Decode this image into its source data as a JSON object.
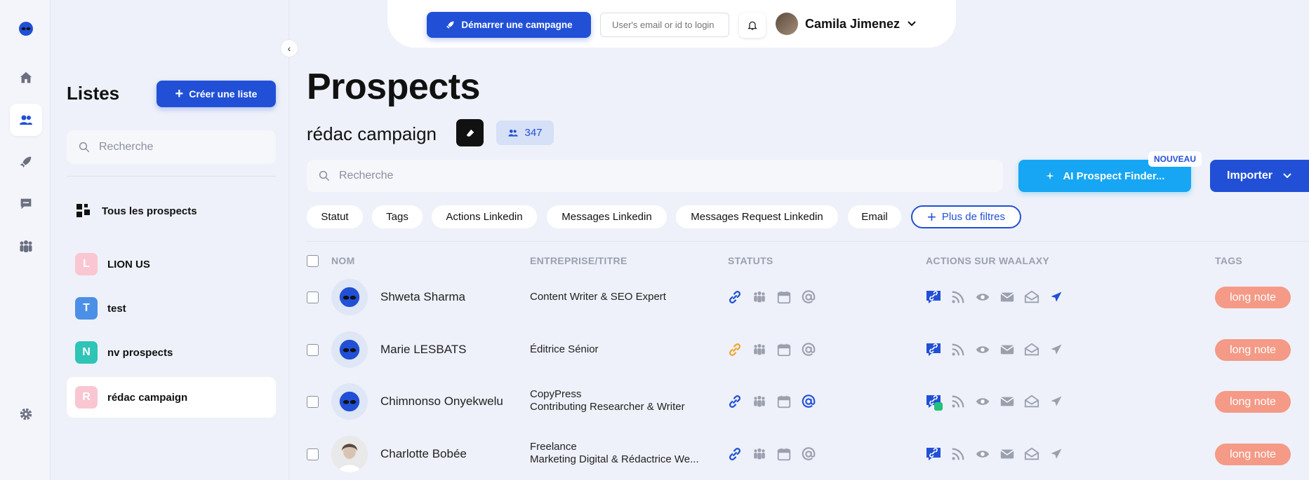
{
  "header": {
    "campaign_button": "Démarrer une campagne",
    "login_placeholder": "User's email or id to login",
    "user_name": "Camila Jimenez"
  },
  "lists_panel": {
    "title": "Listes",
    "create_button": "Créer une liste",
    "search_placeholder": "Recherche",
    "all_prospects": "Tous les prospects",
    "items": [
      {
        "letter": "L",
        "label": "LION US",
        "color": "#f9c6d2"
      },
      {
        "letter": "T",
        "label": "test",
        "color": "#4b8fe6"
      },
      {
        "letter": "N",
        "label": "nv prospects",
        "color": "#2ec4b6"
      },
      {
        "letter": "R",
        "label": "rédac campaign",
        "color": "#f9c6d2"
      }
    ]
  },
  "main": {
    "title": "Prospects",
    "list_name": "rédac campaign",
    "count": "347",
    "search_placeholder": "Recherche",
    "ai_button": "AI Prospect Finder...",
    "new_badge": "NOUVEAU",
    "import_button": "Importer",
    "filters": [
      "Statut",
      "Tags",
      "Actions Linkedin",
      "Messages Linkedin",
      "Messages Request Linkedin",
      "Email"
    ],
    "more_filters": "Plus de filtres",
    "columns": {
      "name": "NOM",
      "company": "ENTREPRISE/TITRE",
      "status": "STATUTS",
      "actions": "ACTIONS SUR WAALAXY",
      "tags": "TAGS"
    },
    "rows": [
      {
        "name": "Shweta Sharma",
        "company_line1": "Content Writer & SEO Expert",
        "company_line2": "",
        "tag": "long note",
        "link_color": "#2150d6",
        "at_color": "#9aa0ae"
      },
      {
        "name": "Marie LESBATS",
        "company_line1": "Éditrice Sénior",
        "company_line2": "",
        "tag": "long note",
        "link_color": "#f2a531",
        "at_color": "#9aa0ae"
      },
      {
        "name": "Chimnonso Onyekwelu",
        "company_line1": "CopyPress",
        "company_line2": "Contributing Researcher & Writer",
        "tag": "long note",
        "link_color": "#2150d6",
        "at_color": "#2150d6"
      },
      {
        "name": "Charlotte Bobée",
        "company_line1": "Freelance",
        "company_line2": "Marketing Digital & Rédactrice We...",
        "tag": "long note",
        "link_color": "#2150d6",
        "at_color": "#9aa0ae"
      }
    ]
  },
  "colors": {
    "primary": "#2150d6",
    "ai": "#16a6f3",
    "tag": "#f49a86",
    "icon_grey": "#9aa0ae"
  }
}
